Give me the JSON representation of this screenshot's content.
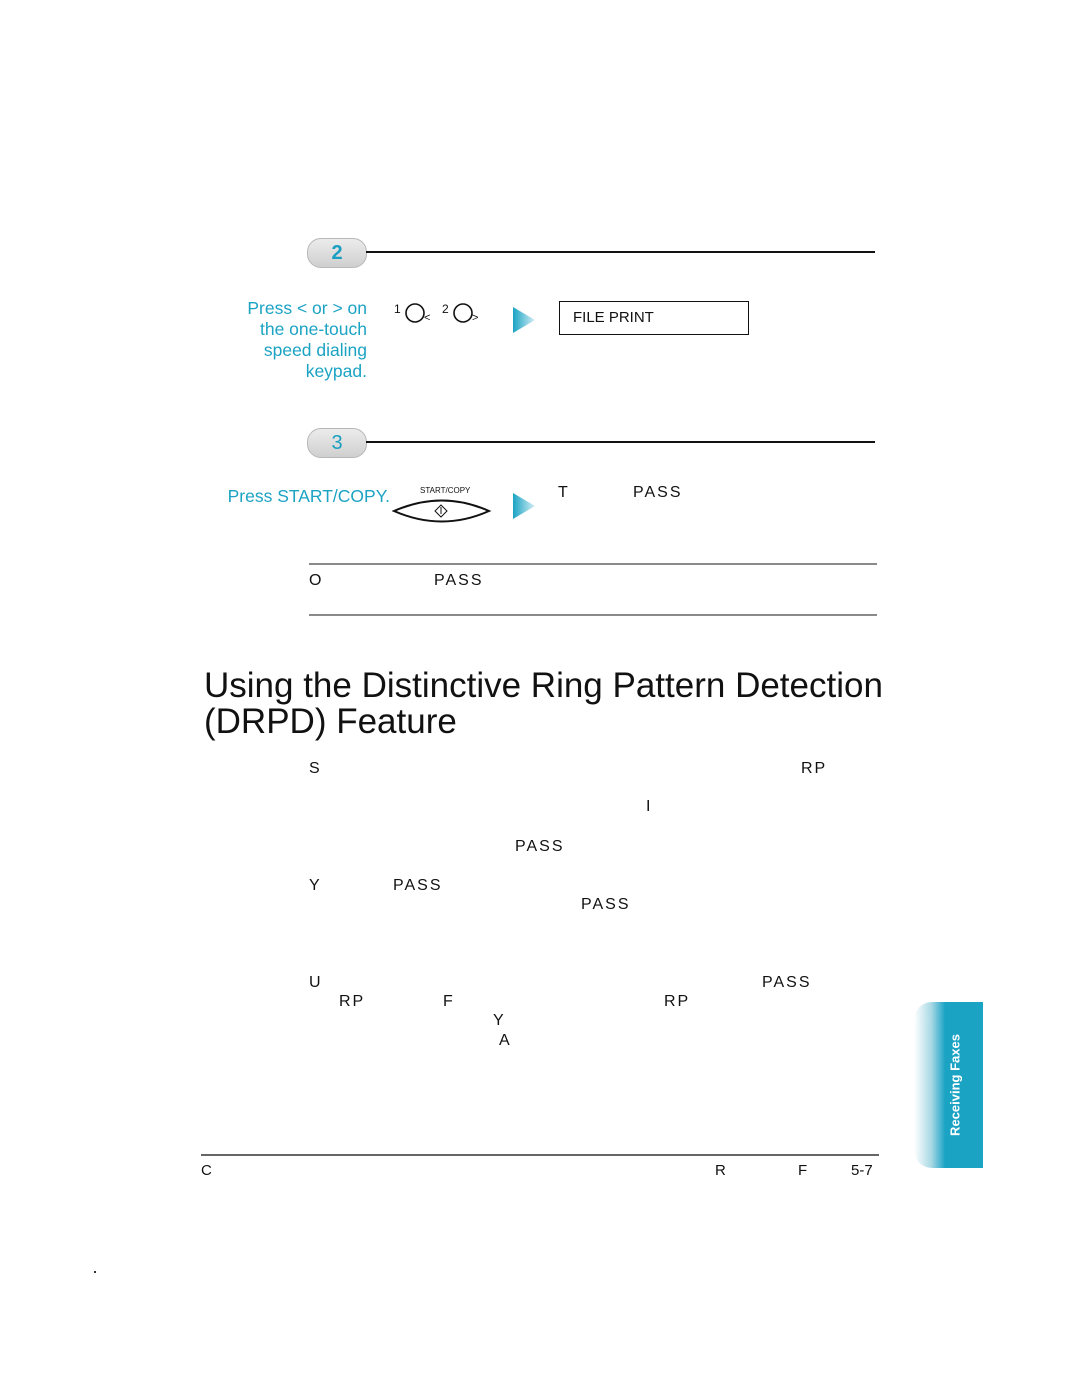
{
  "steps": [
    {
      "number": "2",
      "instruction": [
        "Press  < or > on",
        "the one-touch",
        "speed dialing",
        "keypad."
      ],
      "keys": [
        {
          "num": "1",
          "sub": "<"
        },
        {
          "num": "2",
          "sub": ">"
        }
      ],
      "display": "FILE PRINT"
    },
    {
      "number": "3",
      "instruction": [
        "Press START/COPY."
      ],
      "button_label": "START/COPY",
      "result_fragments": [
        "T",
        "PASS"
      ]
    }
  ],
  "note": {
    "fragments": [
      "O",
      "PASS"
    ]
  },
  "section": {
    "title_line1": "Using the Distinctive Ring Pattern Detection",
    "title_line2": "(DRPD) Feature",
    "body_fragments": {
      "p1": [
        "S",
        "RP",
        "I",
        "PASS"
      ],
      "p2": [
        "Y",
        "PASS",
        "PASS"
      ],
      "p3": [
        "U",
        "PASS",
        "RP",
        "F",
        "RP",
        "Y",
        "A"
      ]
    }
  },
  "side_tab": {
    "label": "Receiving Faxes",
    "color": "#1ba3c4"
  },
  "footer": {
    "left": "C",
    "right_fragments": [
      "R",
      "F"
    ],
    "page": "5-7"
  },
  "colors": {
    "accent": "#1ba3c4"
  }
}
